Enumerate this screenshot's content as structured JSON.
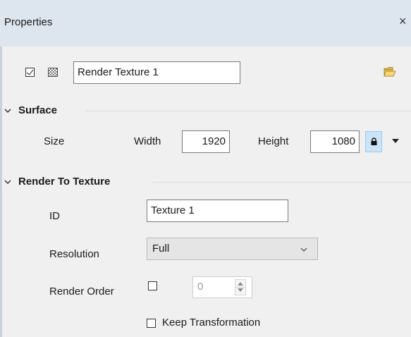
{
  "panel": {
    "title": "Properties",
    "close_glyph": "×"
  },
  "object": {
    "enabled": true,
    "icon": "checkerboard-texture-icon",
    "name": "Render Texture 1",
    "browse_icon": "folder-open-icon"
  },
  "surface": {
    "section_label": "Surface",
    "expanded": true,
    "size_label": "Size",
    "width_label": "Width",
    "width_value": "1920",
    "height_label": "Height",
    "height_value": "1080",
    "lock_icon": "lock-icon",
    "lock_active": true,
    "menu_icon": "dropdown-arrow-icon"
  },
  "render_to_texture": {
    "section_label": "Render To Texture",
    "expanded": true,
    "id_label": "ID",
    "id_value": "Texture 1",
    "resolution_label": "Resolution",
    "resolution_value": "Full",
    "render_order_label": "Render Order",
    "render_order_enabled": false,
    "render_order_value": "0",
    "keep_transformation_label": "Keep Transformation",
    "keep_transformation_checked": false
  },
  "colors": {
    "titlebar": "#dde5ef",
    "panel_bg": "#f0f0f0",
    "lock_button": "#cce4f7",
    "select_bg": "#e5e5e5"
  }
}
